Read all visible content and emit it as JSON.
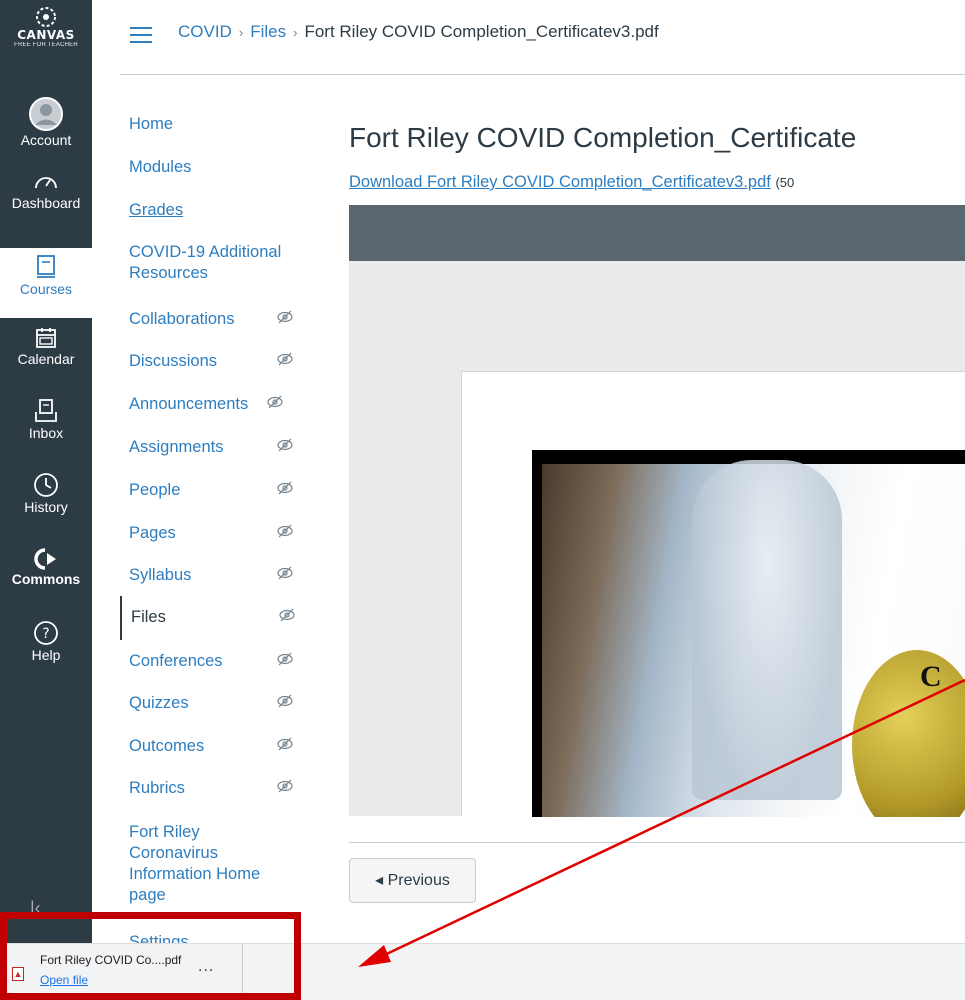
{
  "global_nav": {
    "logo_word": "CANVAS",
    "logo_sub": "FREE FOR TEACHER",
    "items": [
      {
        "label": "Account",
        "icon": "avatar-icon"
      },
      {
        "label": "Dashboard",
        "icon": "dashboard-icon"
      },
      {
        "label": "Courses",
        "icon": "courses-icon"
      },
      {
        "label": "Calendar",
        "icon": "calendar-icon"
      },
      {
        "label": "Inbox",
        "icon": "inbox-icon"
      },
      {
        "label": "History",
        "icon": "history-icon"
      },
      {
        "label": "Commons",
        "icon": "commons-icon"
      },
      {
        "label": "Help",
        "icon": "help-icon"
      }
    ],
    "active": "Courses",
    "colors": {
      "bg": "#2d3b45",
      "active_text": "#2d7dbf"
    }
  },
  "breadcrumb": {
    "items": [
      "COVID",
      "Files",
      "Fort Riley COVID Completion_Certificatev3.pdf"
    ],
    "separator": "›"
  },
  "course_nav": {
    "items": [
      {
        "label": "Home",
        "hidden": false
      },
      {
        "label": "Modules",
        "hidden": false
      },
      {
        "label": "Grades",
        "hidden": false
      },
      {
        "label": "COVID-19 Additional Resources",
        "hidden": false
      },
      {
        "label": "Collaborations",
        "hidden": true
      },
      {
        "label": "Discussions",
        "hidden": true
      },
      {
        "label": "Announcements",
        "hidden": true
      },
      {
        "label": "Assignments",
        "hidden": true
      },
      {
        "label": "People",
        "hidden": true
      },
      {
        "label": "Pages",
        "hidden": true
      },
      {
        "label": "Syllabus",
        "hidden": true
      },
      {
        "label": "Files",
        "hidden": true,
        "active": true
      },
      {
        "label": "Conferences",
        "hidden": true
      },
      {
        "label": "Quizzes",
        "hidden": true
      },
      {
        "label": "Outcomes",
        "hidden": true
      },
      {
        "label": "Rubrics",
        "hidden": true
      },
      {
        "label": "Fort Riley Coronavirus Information Home page",
        "hidden": false
      },
      {
        "label": "Settings",
        "hidden": false
      }
    ]
  },
  "file": {
    "title": "Fort Riley COVID Completion_Certificate",
    "download_link": "Download Fort Riley COVID Completion_Certificatev3.pdf",
    "size_text": "(50",
    "preview_text": "C"
  },
  "pager": {
    "previous_label": "◂ Previous"
  },
  "download_bar": {
    "filename": "Fort Riley COVID Co....pdf",
    "open_label": "Open file",
    "more_label": "...",
    "icon": "pdf-file-icon",
    "highlight_color": "#c00000"
  }
}
